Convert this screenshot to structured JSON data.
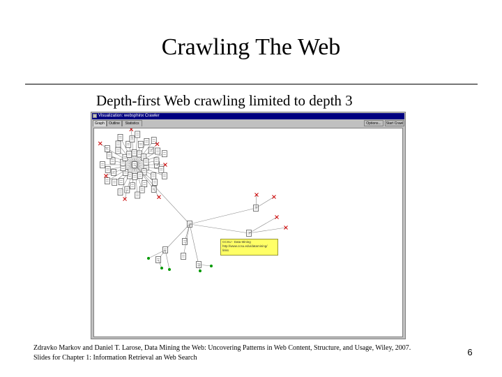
{
  "slide": {
    "title": "Crawling The Web",
    "subtitle": "Depth-first Web crawling limited to depth 3",
    "footer_line1": "Zdravko Markov and Daniel T. Larose, Data Mining the Web: Uncovering Patterns in Web Content, Structure, and Usage, Wiley, 2007.",
    "footer_line2": "Slides for Chapter 1: Information Retrieval an Web Search",
    "page_number": "6"
  },
  "window": {
    "title": "Visualization: websphinx Crawler",
    "tabs": [
      "Graph",
      "Outline",
      "Statistics"
    ],
    "active_tab": "Graph",
    "buttons": {
      "options": "Options...",
      "start": "Start Crawl"
    }
  },
  "tooltip": {
    "line1": "CCSU - Data Mining",
    "line2": "http://www.ccsu.edu/datamining/",
    "line3": "links"
  },
  "colors": {
    "titlebar": "#000080",
    "error_mark": "#cc0000",
    "leaf_mark": "#009900",
    "tooltip_bg": "#ffff66"
  }
}
